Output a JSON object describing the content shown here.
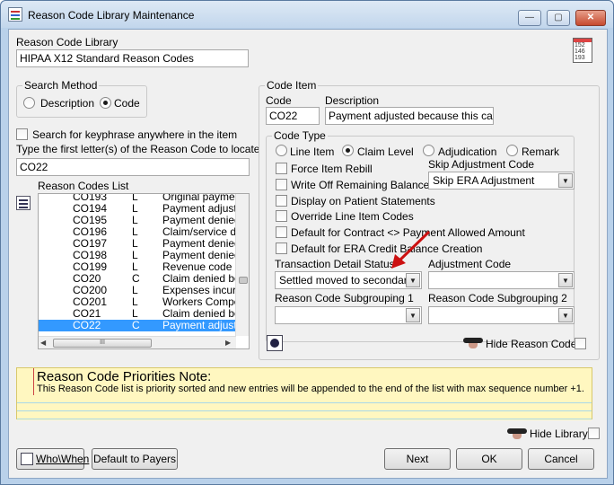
{
  "window": {
    "title": "Reason Code Library Maintenance",
    "controls": {
      "minimize": "—",
      "maximize": "▢",
      "close": "✕"
    }
  },
  "library": {
    "label": "Reason Code Library",
    "value": "HIPAA X12 Standard Reason Codes",
    "calendar_numbers": [
      "152",
      "146",
      "193"
    ]
  },
  "search_method": {
    "title": "Search Method",
    "options": [
      "Description",
      "Code"
    ],
    "selected": "Code"
  },
  "keyphrase_label": "Search for keyphrase anywhere in the item",
  "locate": {
    "label": "Type the first letter(s) of the Reason Code to locate",
    "value": "CO22"
  },
  "codes_list": {
    "label": "Reason Codes List",
    "rows": [
      {
        "code": "CO193",
        "type": "L",
        "desc": "Original paymen"
      },
      {
        "code": "CO194",
        "type": "L",
        "desc": "Payment adjuste"
      },
      {
        "code": "CO195",
        "type": "L",
        "desc": "Payment denied/"
      },
      {
        "code": "CO196",
        "type": "L",
        "desc": "Claim/service de"
      },
      {
        "code": "CO197",
        "type": "L",
        "desc": "Payment denied/"
      },
      {
        "code": "CO198",
        "type": "L",
        "desc": "Payment denied/"
      },
      {
        "code": "CO199",
        "type": "L",
        "desc": "Revenue code a"
      },
      {
        "code": "CO20",
        "type": "C",
        "desc": "Claim denied be"
      },
      {
        "code": "CO200",
        "type": "L",
        "desc": "Expenses incurr"
      },
      {
        "code": "CO201",
        "type": "L",
        "desc": "Workers Comper"
      },
      {
        "code": "CO21",
        "type": "L",
        "desc": "Claim denied be"
      },
      {
        "code": "CO22",
        "type": "C",
        "desc": "Payment adjuste"
      }
    ],
    "selected_index": 11,
    "hscroll_grip": "III"
  },
  "code_item": {
    "title": "Code Item",
    "code_label": "Code",
    "code_value": "CO22",
    "desc_label": "Description",
    "desc_value": "Payment adjusted because this care ma"
  },
  "code_type": {
    "title": "Code Type",
    "options": [
      "Line Item",
      "Claim Level",
      "Adjudication",
      "Remark"
    ],
    "selected": "Claim Level"
  },
  "checkboxes": [
    "Force Item Rebill",
    "Write Off Remaining Balance",
    "Display on Patient Statements",
    "Override Line Item Codes",
    "Default for Contract <> Payment Allowed Amount",
    "Default for ERA Credit Balance Creation"
  ],
  "skip_adjustment": {
    "label": "Skip Adjustment Code",
    "value": "Skip ERA Adjustment"
  },
  "transaction_status": {
    "label": "Transaction Detail Status",
    "value": "Settled moved to secondary"
  },
  "adjustment_code": {
    "label": "Adjustment Code",
    "value": ""
  },
  "subgroup1": {
    "label": "Reason Code Subgrouping 1",
    "value": ""
  },
  "subgroup2": {
    "label": "Reason Code Subgrouping 2",
    "value": ""
  },
  "hide_reason_code": "Hide Reason Code",
  "note": {
    "title": "Reason Code Priorities Note:",
    "text": "This Reason Code list is priority sorted and new entries will be appended to the end of the list with max sequence number +1."
  },
  "hide_library": "Hide Library",
  "buttons": {
    "who_when": "Who\\When",
    "default_payers": "Default to Payers",
    "next": "Next",
    "ok": "OK",
    "cancel": "Cancel"
  },
  "colors": {
    "selection": "#3399ff",
    "note_background": "#fff7c0",
    "arrow": "#cc1111"
  }
}
